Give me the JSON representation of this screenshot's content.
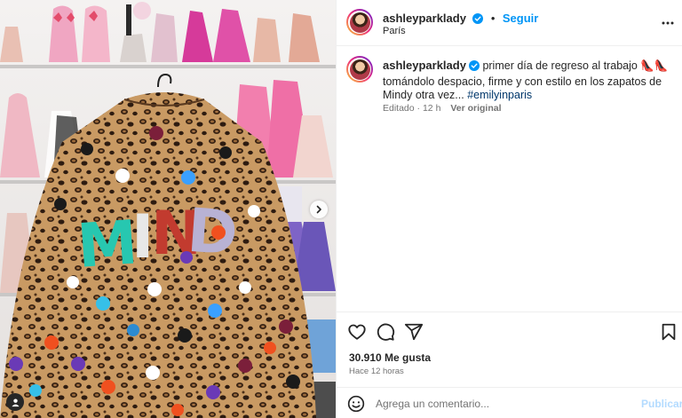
{
  "post": {
    "author": {
      "username": "ashleyparklady",
      "verified": true,
      "follow_label": "Seguir",
      "location": "París"
    },
    "caption": {
      "username": "ashleyparklady",
      "text": "primer día de regreso al trabajo 👠👠 tomándolo despacio, firme y con estilo en los zapatos de Mindy otra vez...",
      "hashtag": "#emilyinparis"
    },
    "meta": {
      "status": "Editado",
      "separator": "·",
      "age": "12 h",
      "see_original": "Ver original"
    },
    "likes_label": "30.910 Me gusta",
    "timestamp": "Hace 12 horas",
    "image": {
      "jacket_text": "MINDY"
    }
  },
  "comment": {
    "placeholder": "Agrega un comentario...",
    "post_label": "Publicar"
  },
  "icons": {
    "more": "more-options-icon",
    "like": "heart-icon",
    "comment": "comment-icon",
    "share": "share-icon",
    "save": "bookmark-icon",
    "emoji": "emoji-icon",
    "verified": "verified-badge-icon",
    "next": "chevron-right-icon",
    "tagged": "user-tag-icon"
  },
  "colors": {
    "accent": "#0095f6",
    "verified": "#0095f6",
    "muted": "#737373",
    "hashtag": "#00376b"
  }
}
